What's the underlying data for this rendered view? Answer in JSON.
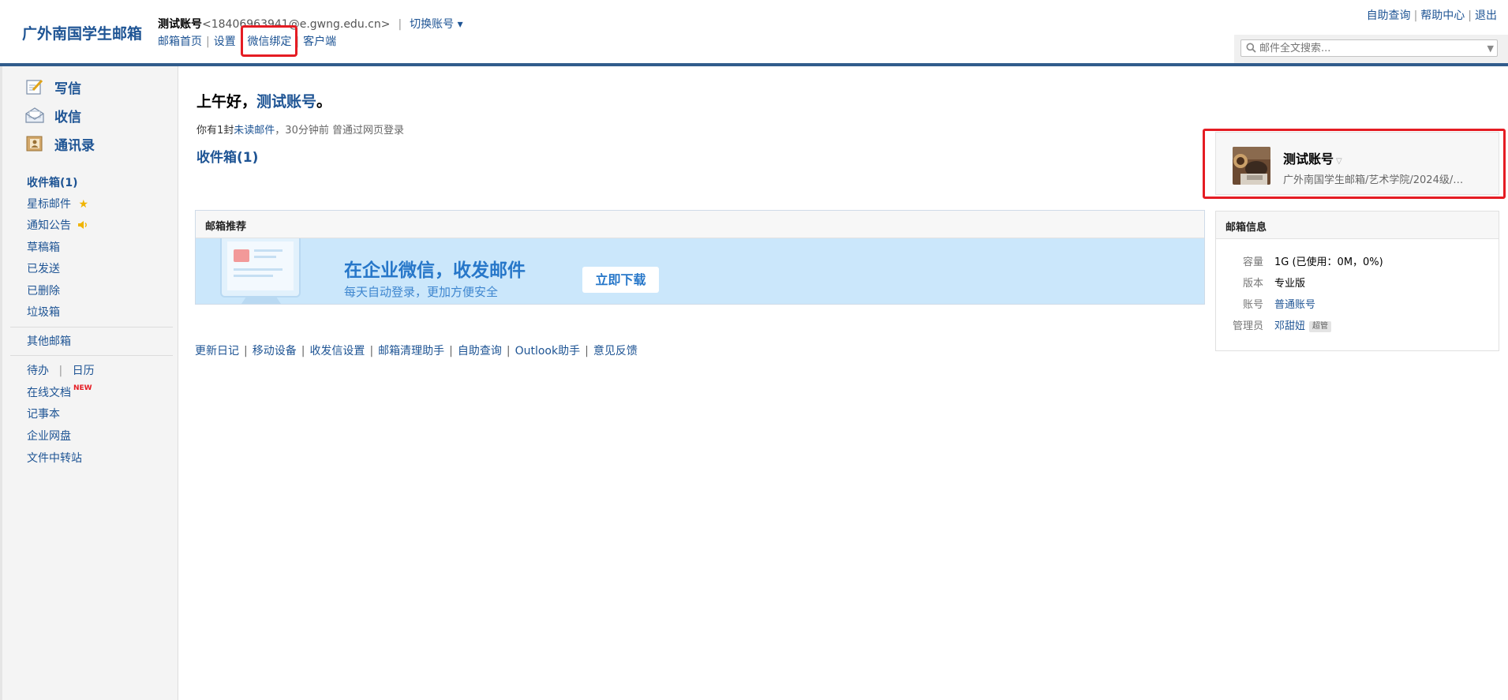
{
  "header": {
    "logo": "广外南国学生邮箱",
    "account_name": "测试账号",
    "account_email": "<18406963941@e.gwng.edu.cn>",
    "switch_account": "切换账号 ▾",
    "nav": {
      "home": "邮箱首页",
      "settings": "设置",
      "wechat_bind": "微信绑定",
      "client": "客户端"
    },
    "right_links": {
      "self_query": "自助查询",
      "help": "帮助中心",
      "logout": "退出"
    },
    "search_placeholder": "邮件全文搜索..."
  },
  "sidebar": {
    "compose": "写信",
    "receive": "收信",
    "contacts": "通讯录",
    "folders": {
      "inbox": "收件箱(1)",
      "starred": "星标邮件",
      "notices": "通知公告",
      "drafts": "草稿箱",
      "sent": "已发送",
      "deleted": "已删除",
      "trash": "垃圾箱"
    },
    "other_mail": "其他邮箱",
    "todo": "待办",
    "calendar": "日历",
    "online_docs": "在线文档",
    "new_badge": "NEW",
    "notes": "记事本",
    "netdisk": "企业网盘",
    "transfer": "文件中转站"
  },
  "main": {
    "greeting_prefix": "上午好，",
    "greeting_name": "测试账号",
    "greeting_suffix": "。",
    "info_prefix": "你有1封",
    "unread_link": "未读邮件",
    "info_suffix": "，30分钟前 曾通过网页登录",
    "inbox_link": "收件箱(1)",
    "promo": {
      "header": "邮箱推荐",
      "title": "在企业微信，收发邮件",
      "subtitle": "每天自动登录，更加方便安全",
      "button": "立即下载"
    },
    "tool_links": [
      "更新日记",
      "移动设备",
      "收发信设置",
      "邮箱清理助手",
      "自助查询",
      "Outlook助手",
      "意见反馈"
    ]
  },
  "profile": {
    "name": "测试账号",
    "org": "广外南国学生邮箱/艺术学院/2024级/…"
  },
  "mailbox_info": {
    "header": "邮箱信息",
    "rows": [
      {
        "key": "容量",
        "value": "1G (已使用：0M，0%)"
      },
      {
        "key": "版本",
        "value": "专业版"
      },
      {
        "key": "账号",
        "value": "普通账号"
      },
      {
        "key": "管理员",
        "value": "邓甜妞",
        "tag": "超管"
      }
    ]
  },
  "colors": {
    "link": "#1e5494",
    "highlight": "#e51c23",
    "promo_bg": "#cbe7fb",
    "rule": "#315c8c"
  }
}
